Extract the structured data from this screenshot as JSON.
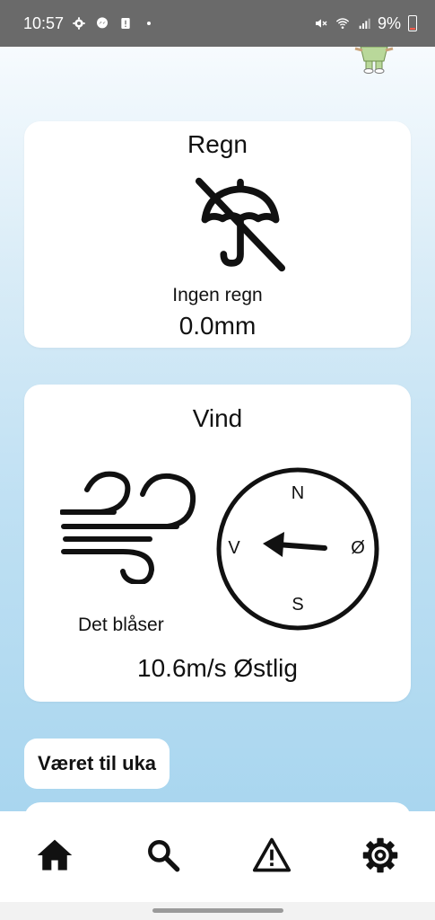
{
  "status_bar": {
    "time": "10:57",
    "battery_percent": "9%",
    "icons": [
      "settings-icon",
      "messenger-icon",
      "alert-icon",
      "dot-icon",
      "mute-icon",
      "wifi-icon",
      "signal-icon",
      "battery-icon"
    ]
  },
  "rain": {
    "title": "Regn",
    "icon": "no-umbrella-icon",
    "description": "Ingen regn",
    "amount": "0.0mm"
  },
  "wind": {
    "title": "Vind",
    "icon": "wind-icon",
    "description": "Det blåser",
    "speed_direction": "10.6m/s Østlig",
    "compass": {
      "n": "N",
      "s": "S",
      "w": "V",
      "e": "Ø"
    }
  },
  "week": {
    "label": "Været til uka"
  },
  "nav": [
    {
      "name": "home",
      "icon": "home-icon"
    },
    {
      "name": "search",
      "icon": "search-icon"
    },
    {
      "name": "warnings",
      "icon": "warning-icon"
    },
    {
      "name": "settings",
      "icon": "gear-icon"
    }
  ]
}
